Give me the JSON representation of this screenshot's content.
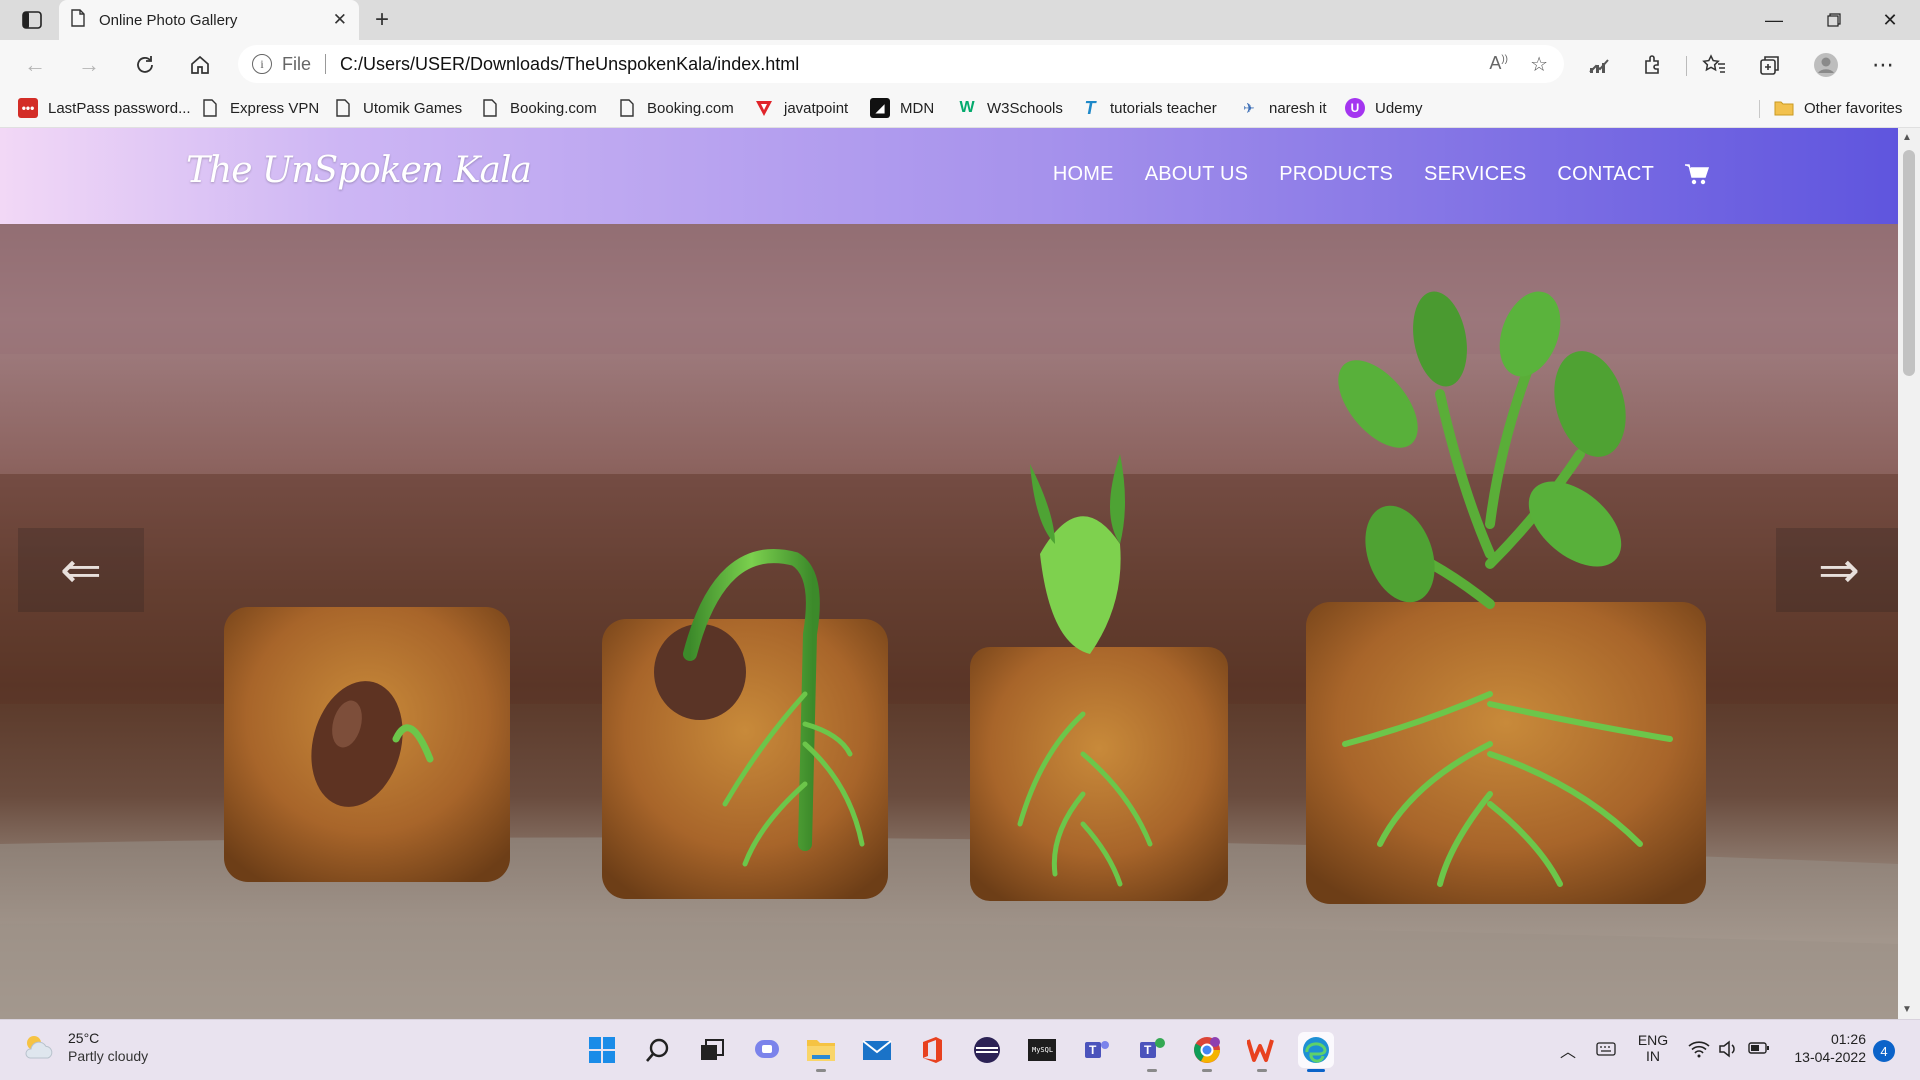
{
  "browser": {
    "tab_title": "Online Photo Gallery",
    "address_prefix": "File",
    "url": "C:/Users/USER/Downloads/TheUnspokenKala/index.html",
    "bookmarks": [
      {
        "label": "LastPass password...",
        "icon": "lastpass-icon",
        "color": "#d32d27"
      },
      {
        "label": "Express VPN",
        "icon": "page-icon",
        "color": "#444444"
      },
      {
        "label": "Utomik Games",
        "icon": "page-icon",
        "color": "#444444"
      },
      {
        "label": "Booking.com",
        "icon": "page-icon",
        "color": "#444444"
      },
      {
        "label": "Booking.com",
        "icon": "page-icon",
        "color": "#444444"
      },
      {
        "label": "javatpoint",
        "icon": "javatpoint-icon",
        "color": "#e0242a"
      },
      {
        "label": "MDN",
        "icon": "mdn-icon",
        "color": "#111111"
      },
      {
        "label": "W3Schools",
        "icon": "w3schools-icon",
        "color": "#04aa6d"
      },
      {
        "label": "tutorials teacher",
        "icon": "tutorialsteacher-icon",
        "color": "#1e88c8"
      },
      {
        "label": "naresh it",
        "icon": "nareshit-icon",
        "color": "#3b6db5"
      },
      {
        "label": "Udemy",
        "icon": "udemy-icon",
        "color": "#a435f0"
      }
    ],
    "other_favorites": "Other favorites"
  },
  "site": {
    "brand": "The UnSpoken Kala",
    "nav": [
      "HOME",
      "ABOUT US",
      "PRODUCTS",
      "SERVICES",
      "CONTACT"
    ],
    "prev_arrow": "⇐",
    "next_arrow": "⇒"
  },
  "taskbar": {
    "weather_temp": "25°C",
    "weather_desc": "Partly cloudy",
    "apps": [
      "start-icon",
      "search-icon",
      "task-view-icon",
      "teams-chat-icon",
      "file-explorer-icon",
      "mail-icon",
      "office-icon",
      "eclipse-icon",
      "mysql-icon",
      "teams-icon",
      "teams-work-icon",
      "chrome-icon",
      "wps-icon",
      "edge-icon"
    ],
    "lang_line1": "ENG",
    "lang_line2": "IN",
    "time": "01:26",
    "date": "13-04-2022",
    "notification_count": "4"
  }
}
